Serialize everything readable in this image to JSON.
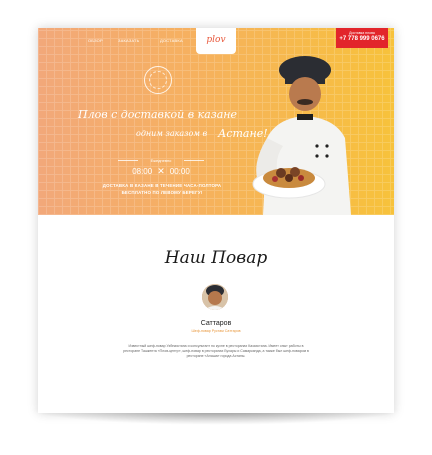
{
  "nav": {
    "items": [
      "Обзор",
      "Заказать",
      "Доставка"
    ]
  },
  "logo": {
    "text": "plov"
  },
  "phone": {
    "label": "Доставка плова",
    "number": "+7 778 999 0676"
  },
  "hero": {
    "title_line1": "Плов с доставкой в казане",
    "title_line2a": "одним заказом в",
    "title_line2b": "Астане!",
    "hours_label": "Ежедневно",
    "hours_open": "08:00",
    "hours_close": "00:00",
    "delivery_line1": "ДОСТАВКА В КАЗАНЕ В ТЕЧЕНИЕ ЧАСА-ПОЛТОРА",
    "delivery_line2": "БЕСПЛАТНО ПО ЛЕВОМУ БЕРЕГУ!"
  },
  "chef_section": {
    "title": "Наш Повар",
    "name": "Саттаров",
    "role": "Шеф-повар Рустам Саттаров",
    "bio": "Известный шеф-повар Узбекистана и консультант по кухне в ресторанах Казахстана. Имеет опыт работы в ресторане Ташкента «Плов-центр», шеф-повар в ресторанах Бухары и Самарканда, а также был шеф-поваром в ресторане «Алаша» города Астаны."
  },
  "colors": {
    "accent_red": "#e2252b",
    "accent_orange": "#e8963a"
  }
}
